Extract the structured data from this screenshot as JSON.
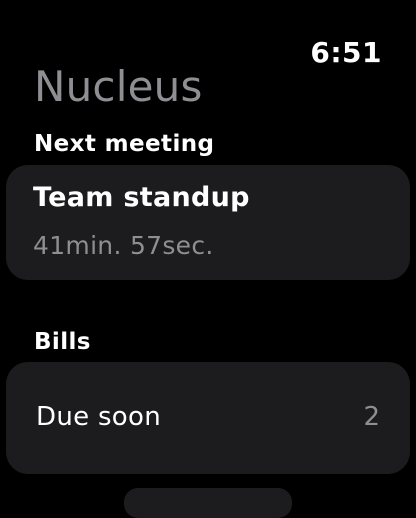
{
  "status": {
    "time": "6:51"
  },
  "app": {
    "title": "Nucleus"
  },
  "next_meeting": {
    "section_label": "Next meeting",
    "title": "Team standup",
    "countdown": "41min. 57sec."
  },
  "bills": {
    "section_label": "Bills",
    "row_label": "Due soon",
    "count": "2"
  },
  "colors": {
    "background": "#000000",
    "card": "#1c1c1e",
    "secondary_text": "#8e8e93",
    "primary_text": "#ffffff"
  }
}
